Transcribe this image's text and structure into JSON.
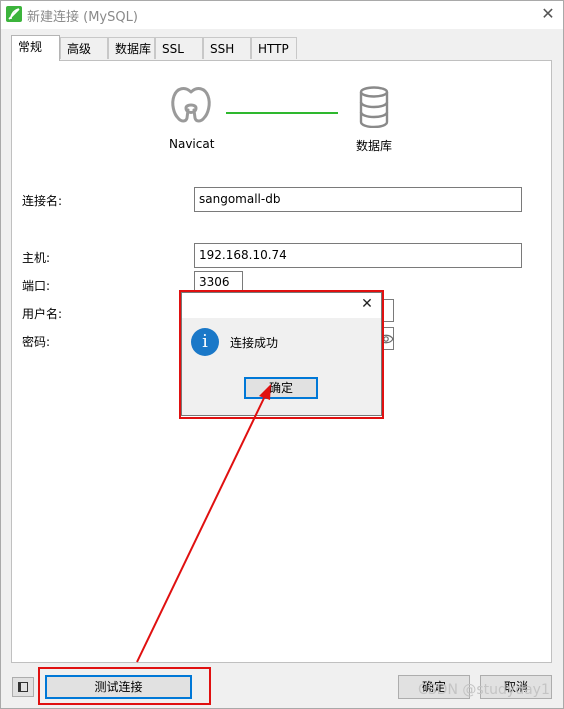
{
  "window": {
    "title": "新建连接 (MySQL)",
    "close_glyph": "✕",
    "logo_icon": "navicat-leaf-icon"
  },
  "tabs": [
    {
      "label": "常规",
      "active": true
    },
    {
      "label": "高级",
      "active": false
    },
    {
      "label": "数据库",
      "active": false
    },
    {
      "label": "SSL",
      "active": false
    },
    {
      "label": "SSH",
      "active": false
    },
    {
      "label": "HTTP",
      "active": false
    }
  ],
  "diagram": {
    "left_label": "Navicat",
    "right_label": "数据库",
    "link_color": "#2eb82e"
  },
  "form": {
    "connection_name_label": "连接名:",
    "connection_name_value": "sangomall-db",
    "host_label": "主机:",
    "host_value": "192.168.10.74",
    "port_label": "端口:",
    "port_value": "3306",
    "user_label": "用户名:",
    "password_label": "密码:"
  },
  "dialog": {
    "message": "连接成功",
    "ok_label": "确定",
    "close_glyph": "✕",
    "info_icon": "info-icon",
    "info_glyph": "i"
  },
  "bottom": {
    "test_button_label": "测试连接",
    "ok_label": "确定",
    "cancel_label": "取消",
    "watermark": "CSDN @studyday1"
  },
  "colors": {
    "annotation_red": "#e01010",
    "accent_blue": "#0078d7",
    "info_blue": "#1a78c8"
  }
}
